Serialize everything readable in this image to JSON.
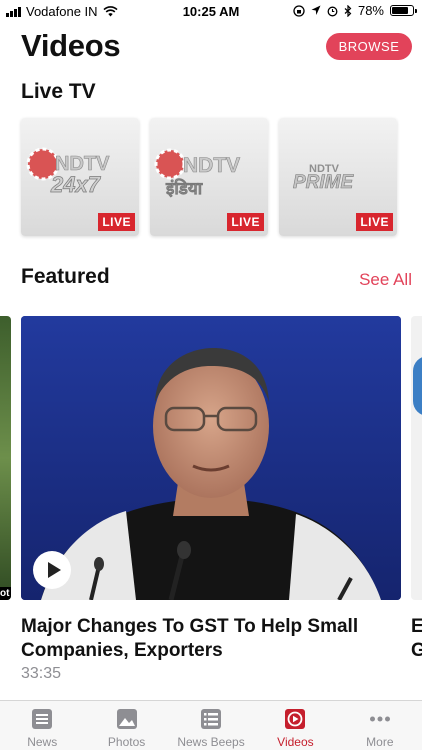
{
  "status_bar": {
    "carrier": "Vodafone IN",
    "time": "10:25 AM",
    "battery": "78%",
    "battery_level": 0.78
  },
  "header": {
    "title": "Videos",
    "browse_label": "BROWSE"
  },
  "live_tv": {
    "title": "Live TV",
    "channels": [
      {
        "logo_line1": "NDTV",
        "logo_line2": "24x7",
        "badge": "LIVE"
      },
      {
        "logo_line1": "NDTV",
        "logo_line2": "इंडिया",
        "badge": "LIVE"
      },
      {
        "logo_line1": "NDTV",
        "logo_line2": "PRIME",
        "badge": "LIVE"
      }
    ]
  },
  "featured": {
    "title": "Featured",
    "see_all_label": "See All",
    "prev_card_text": "ot",
    "items": [
      {
        "headline": "Major Changes To GST To Help Small Companies, Exporters",
        "duration": "33:35"
      }
    ],
    "next_card_headline": "E G"
  },
  "tab_bar": {
    "tabs": [
      {
        "label": "News",
        "icon": "news-icon",
        "active": false
      },
      {
        "label": "Photos",
        "icon": "photos-icon",
        "active": false
      },
      {
        "label": "News Beeps",
        "icon": "news-beeps-icon",
        "active": false
      },
      {
        "label": "Videos",
        "icon": "videos-icon",
        "active": true
      },
      {
        "label": "More",
        "icon": "more-icon",
        "active": false
      }
    ]
  },
  "colors": {
    "accent": "#e2435a",
    "live_badge": "#d8262e",
    "active_tab": "#c51f2d"
  }
}
